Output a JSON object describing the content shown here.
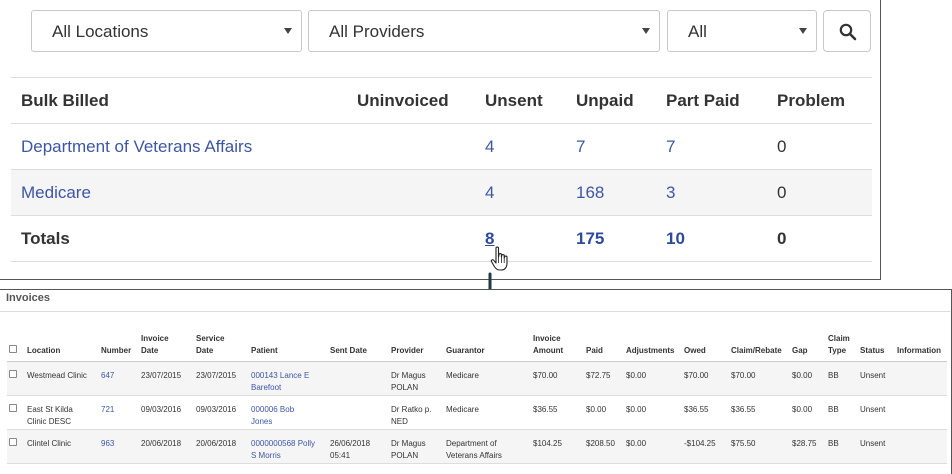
{
  "filters": {
    "location": "All Locations",
    "provider": "All Providers",
    "status": "All"
  },
  "summary": {
    "headers": [
      "Bulk Billed",
      "Uninvoiced",
      "Unsent",
      "Unpaid",
      "Part Paid",
      "Problem"
    ],
    "rows": [
      {
        "name": "Department of Veterans Affairs",
        "uninvoiced": "",
        "unsent": "4",
        "unpaid": "7",
        "part_paid": "7",
        "problem": "0"
      },
      {
        "name": "Medicare",
        "uninvoiced": "",
        "unsent": "4",
        "unpaid": "168",
        "part_paid": "3",
        "problem": "0"
      }
    ],
    "totals": {
      "label": "Totals",
      "uninvoiced": "",
      "unsent": "8",
      "unpaid": "175",
      "part_paid": "10",
      "problem": "0"
    }
  },
  "invoices": {
    "title": "Invoices",
    "headers": {
      "location": "Location",
      "number": "Number",
      "invoice_date_1": "Invoice",
      "invoice_date_2": "Date",
      "service_date_1": "Service",
      "service_date_2": "Date",
      "patient": "Patient",
      "sent_date": "Sent Date",
      "provider": "Provider",
      "guarantor": "Guarantor",
      "invoice_amount_1": "Invoice",
      "invoice_amount_2": "Amount",
      "paid": "Paid",
      "adjustments": "Adjustments",
      "owed": "Owed",
      "claim_rebate": "Claim/Rebate",
      "gap": "Gap",
      "claim_type_1": "Claim",
      "claim_type_2": "Type",
      "status": "Status",
      "information": "Information"
    },
    "rows": [
      {
        "location": "Westmead Clinic",
        "number": "647",
        "invoice_date": "23/07/2015",
        "service_date": "23/07/2015",
        "patient_1": "000143 Lance E",
        "patient_2": "Barefoot",
        "sent_1": "",
        "sent_2": "",
        "provider_1": "Dr Magus",
        "provider_2": "POLAN",
        "guarantor_1": "Medicare",
        "guarantor_2": "",
        "invoice_amount": "$70.00",
        "paid": "$72.75",
        "adjustments": "$0.00",
        "owed": "$70.00",
        "claim_rebate": "$70.00",
        "gap": "$0.00",
        "claim_type": "BB",
        "status": "Unsent",
        "information": ""
      },
      {
        "location_1": "East St Kilda",
        "location_2": "Clinic DESC",
        "number": "721",
        "invoice_date": "09/03/2016",
        "service_date": "09/03/2016",
        "patient_1": "000006 Bob",
        "patient_2": "Jones",
        "sent_1": "",
        "sent_2": "",
        "provider_1": "Dr Ratko p.",
        "provider_2": "NED",
        "guarantor_1": "Medicare",
        "guarantor_2": "",
        "invoice_amount": "$36.55",
        "paid": "$0.00",
        "adjustments": "$0.00",
        "owed": "$36.55",
        "claim_rebate": "$36.55",
        "gap": "$0.00",
        "claim_type": "BB",
        "status": "Unsent",
        "information": ""
      },
      {
        "location": "Clintel Clinic",
        "number": "963",
        "invoice_date": "20/06/2018",
        "service_date": "20/06/2018",
        "patient_1": "0000000568 Polly",
        "patient_2": "S Morris",
        "sent_1": "26/06/2018",
        "sent_2": "05:41",
        "provider_1": "Dr Magus",
        "provider_2": "POLAN",
        "guarantor_1": "Department of",
        "guarantor_2": "Veterans Affairs",
        "invoice_amount": "$104.25",
        "paid": "$208.50",
        "adjustments": "$0.00",
        "owed": "-$104.25",
        "claim_rebate": "$75.50",
        "gap": "$28.75",
        "claim_type": "BB",
        "status": "Unsent",
        "information": ""
      }
    ]
  },
  "icons": {
    "search": "search-icon",
    "pointer": "hand-pointer-icon",
    "arrow": "arrow-down-icon",
    "caret": "chevron-down-icon",
    "checkbox": "checkbox-icon"
  },
  "colors": {
    "link": "#3d56a6",
    "totals_link": "#2c4aa0",
    "stripe": "#f5f5f5"
  }
}
